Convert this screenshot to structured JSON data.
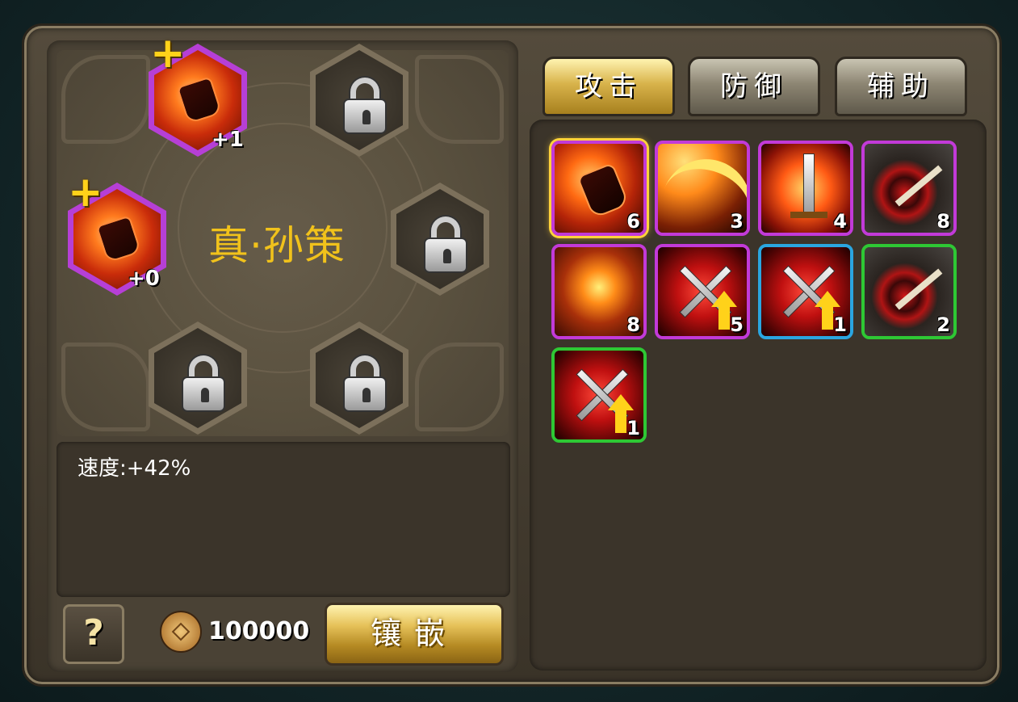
{
  "hero": {
    "name": "真·孙策"
  },
  "sockets": [
    {
      "slot": "top-left",
      "state": "gem",
      "level": "+1",
      "has_plus": true
    },
    {
      "slot": "top-right",
      "state": "locked"
    },
    {
      "slot": "mid-left",
      "state": "gem",
      "level": "+0",
      "has_plus": true
    },
    {
      "slot": "mid-right",
      "state": "locked"
    },
    {
      "slot": "bottom-left",
      "state": "locked"
    },
    {
      "slot": "bottom-right",
      "state": "locked"
    }
  ],
  "stats": {
    "line1": "速度:+42%"
  },
  "footer": {
    "help_label": "?",
    "cost": "100000",
    "embed_label": "镶嵌"
  },
  "tabs": [
    {
      "label": "攻击",
      "active": true
    },
    {
      "label": "防御",
      "active": false
    },
    {
      "label": "辅助",
      "active": false
    }
  ],
  "items": [
    {
      "icon": "fire-gem-icon",
      "count": "6",
      "border": "#c23ad8",
      "selected": true
    },
    {
      "icon": "flame-blade-icon",
      "count": "3",
      "border": "#c23ad8"
    },
    {
      "icon": "flaming-sword-icon",
      "count": "4",
      "border": "#c23ad8"
    },
    {
      "icon": "target-arrow-icon",
      "count": "8",
      "border": "#c23ad8"
    },
    {
      "icon": "fire-burst-icon",
      "count": "8",
      "border": "#c23ad8"
    },
    {
      "icon": "crossed-swords-up-icon",
      "count": "5",
      "border": "#c23ad8"
    },
    {
      "icon": "crossed-swords-up-icon",
      "count": "1",
      "border": "#2aa6e0"
    },
    {
      "icon": "target-arrow-icon",
      "count": "2",
      "border": "#2ec834"
    },
    {
      "icon": "crossed-swords-up-icon",
      "count": "1",
      "border": "#2ec834"
    }
  ]
}
